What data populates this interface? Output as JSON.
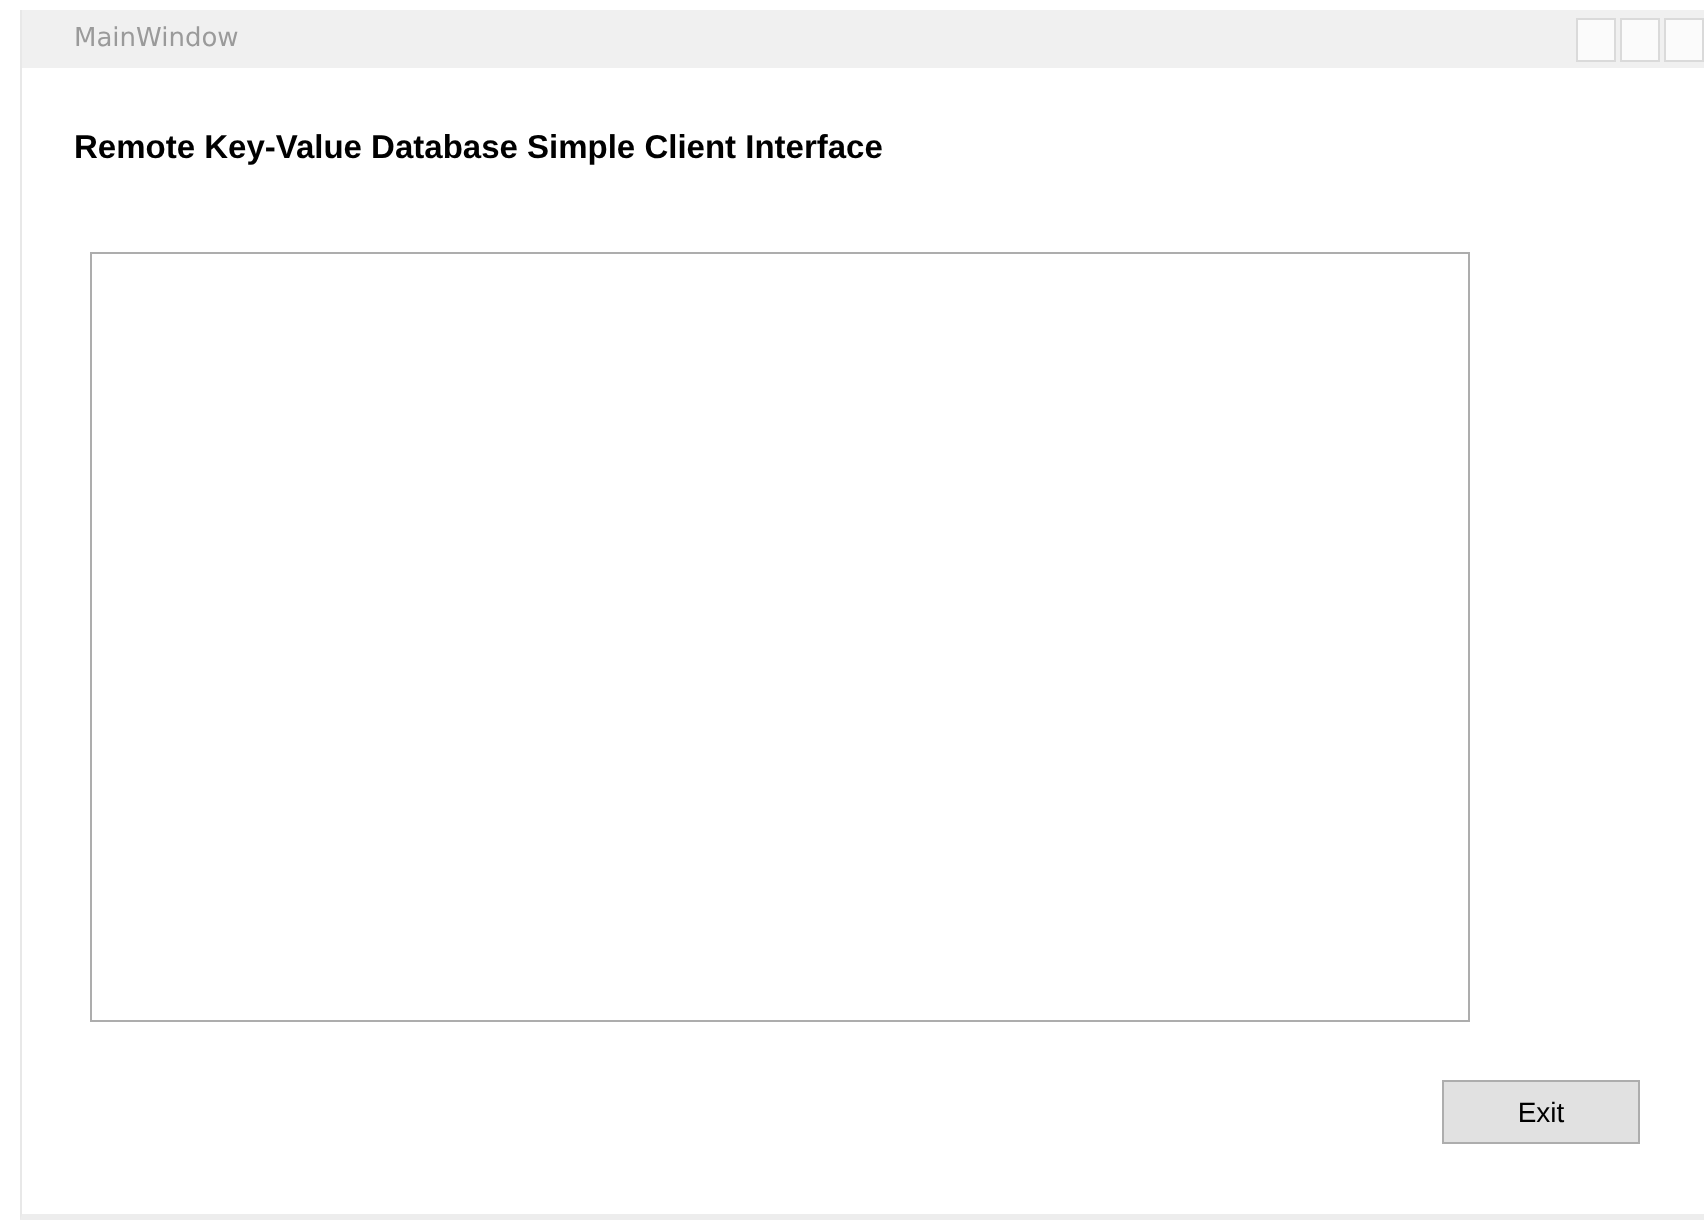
{
  "window": {
    "title": "MainWindow"
  },
  "heading": "Remote Key-Value Database Simple Client Interface",
  "buttons": [
    {
      "label": "Exit"
    }
  ]
}
